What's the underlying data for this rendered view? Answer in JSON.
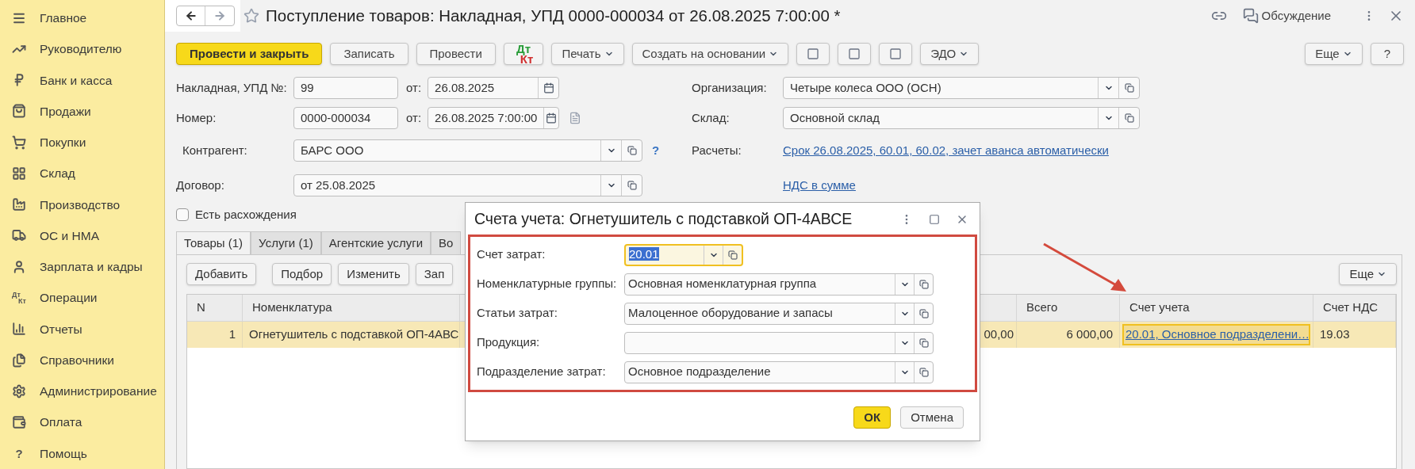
{
  "sidebar": {
    "items": [
      {
        "label": "Главное"
      },
      {
        "label": "Руководителю"
      },
      {
        "label": "Банк и касса"
      },
      {
        "label": "Продажи"
      },
      {
        "label": "Покупки"
      },
      {
        "label": "Склад"
      },
      {
        "label": "Производство"
      },
      {
        "label": "ОС и НМА"
      },
      {
        "label": "Зарплата и кадры"
      },
      {
        "label": "Операции",
        "mark_text": [
          "Дт",
          "Кт"
        ]
      },
      {
        "label": "Отчеты"
      },
      {
        "label": "Справочники"
      },
      {
        "label": "Администрирование"
      },
      {
        "label": "Оплата"
      },
      {
        "label": "Помощь",
        "mark_text": [
          "?"
        ]
      }
    ]
  },
  "window": {
    "title": "Поступление товаров: Накладная, УПД 0000-000034 от 26.08.2025 7:00:00 *",
    "discussion": "Обсуждение"
  },
  "toolbar": {
    "left": [
      {
        "label": "Провести и закрыть",
        "kind": "primary"
      },
      {
        "label": "Записать",
        "kind": "button"
      },
      {
        "label": "Провести",
        "kind": "button"
      },
      {
        "kind": "dtkt",
        "mark_text": [
          "Дт",
          "Кт"
        ]
      },
      {
        "label": "Печать",
        "kind": "menu"
      },
      {
        "label": "Создать на основании",
        "kind": "menu"
      },
      {
        "kind": "icon"
      },
      {
        "kind": "icon"
      },
      {
        "kind": "icon"
      },
      {
        "label": "ЭДО",
        "kind": "menu"
      }
    ],
    "right": [
      {
        "label": "Еще",
        "kind": "menu"
      },
      {
        "label": "?",
        "kind": "button"
      }
    ]
  },
  "form": {
    "left": [
      {
        "label": "Накладная, УПД №:",
        "value": "99",
        "kind": "text",
        "date_label": "от:",
        "date": "26.08.2025"
      },
      {
        "label": "Номер:",
        "value": "0000-000034",
        "kind": "text",
        "date_label": "от:",
        "date": "26.08.2025  7:00:00",
        "extra": true
      },
      {
        "label": "Контрагент:",
        "value": "БАРС ООО",
        "kind": "select",
        "help": "?"
      },
      {
        "label": "Договор:",
        "value": "от 25.08.2025",
        "kind": "select"
      }
    ],
    "right": [
      {
        "label": "Организация:",
        "value": "Четыре колеса ООО (ОСН)",
        "kind": "select"
      },
      {
        "label": "Склад:",
        "value": "Основной склад",
        "kind": "select"
      },
      {
        "label": "Расчеты:",
        "value": "Срок 26.08.2025, 60.01, 60.02, зачет аванса автоматически",
        "kind": "link"
      },
      {
        "value": "НДС в сумме",
        "kind": "link"
      }
    ],
    "discrepancy": {
      "label": "Есть расхождения",
      "checked": false
    }
  },
  "tabs": [
    {
      "label": "Товары (1)",
      "selected": true
    },
    {
      "label": "Услуги (1)",
      "selected": false
    },
    {
      "label": "Агентские услуги",
      "selected": false
    },
    {
      "label": "Во",
      "selected": false
    }
  ],
  "table_toolbar": {
    "buttons": [
      "Добавить",
      "Подбор",
      "Изменить",
      "Зап"
    ],
    "more": "Еще"
  },
  "table": {
    "columns": [
      "N",
      "Номенклатура",
      "",
      "Всего",
      "Счет учета",
      "Счет НДС"
    ],
    "rows": [
      {
        "selected": true,
        "cells": [
          "1",
          "Огнетушитель с подставкой ОП-4АВС",
          "00,00",
          "6 000,00",
          "20.01, Основное подразделени…",
          "19.03"
        ]
      }
    ]
  },
  "dialog": {
    "title": "Счета учета: Огнетушитель с подставкой ОП-4АВСЕ",
    "fields": [
      {
        "label": "Счет затрат:",
        "value": "20.01",
        "focused": true
      },
      {
        "label": "Номенклатурные группы:",
        "value": "Основная номенклатурная группа",
        "focused": false
      },
      {
        "label": "Статьи затрат:",
        "value": "Малоценное оборудование и запасы",
        "focused": false
      },
      {
        "label": "Продукция:",
        "focused": false
      },
      {
        "label": "Подразделение затрат:",
        "value": "Основное подразделение",
        "focused": false
      }
    ],
    "buttons": [
      {
        "label": "ОК",
        "kind": "primary"
      },
      {
        "label": "Отмена",
        "kind": "button"
      }
    ]
  }
}
